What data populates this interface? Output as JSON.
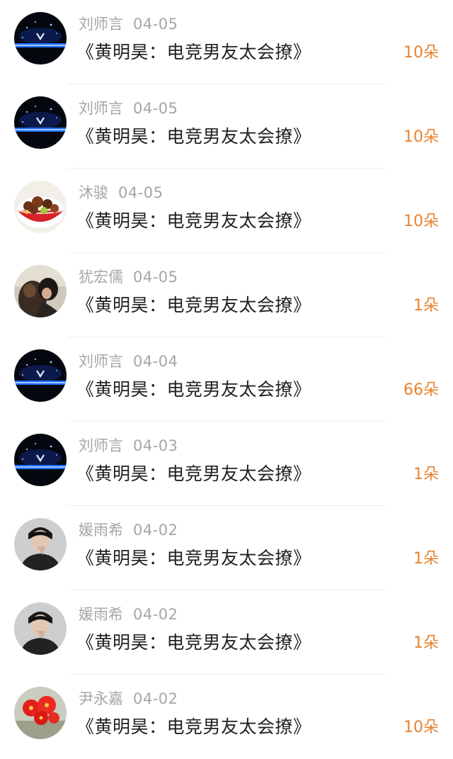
{
  "colors": {
    "gift_accent": "#e8822e",
    "meta_text": "#a6a6a6",
    "title_text": "#222222"
  },
  "items": [
    {
      "avatar": "galaxy-avatar",
      "name": "刘师言",
      "date": "04-05",
      "title": "《黄明昊：电竞男友太会撩》",
      "gift": "10朵"
    },
    {
      "avatar": "galaxy-avatar",
      "name": "刘师言",
      "date": "04-05",
      "title": "《黄明昊：电竞男友太会撩》",
      "gift": "10朵"
    },
    {
      "avatar": "food-bowl-avatar",
      "name": "沐骏",
      "date": "04-05",
      "title": "《黄明昊：电竞男友太会撩》",
      "gift": "10朵"
    },
    {
      "avatar": "person-dog-avatar",
      "name": "犹宏儒",
      "date": "04-05",
      "title": "《黄明昊：电竞男友太会撩》",
      "gift": "1朵"
    },
    {
      "avatar": "galaxy-avatar",
      "name": "刘师言",
      "date": "04-04",
      "title": "《黄明昊：电竞男友太会撩》",
      "gift": "66朵"
    },
    {
      "avatar": "galaxy-avatar",
      "name": "刘师言",
      "date": "04-03",
      "title": "《黄明昊：电竞男友太会撩》",
      "gift": "1朵"
    },
    {
      "avatar": "man-portrait-avatar",
      "name": "媛雨希",
      "date": "04-02",
      "title": "《黄明昊：电竞男友太会撩》",
      "gift": "1朵"
    },
    {
      "avatar": "man-portrait-avatar",
      "name": "媛雨希",
      "date": "04-02",
      "title": "《黄明昊：电竞男友太会撩》",
      "gift": "1朵"
    },
    {
      "avatar": "red-flower-avatar",
      "name": "尹永嘉",
      "date": "04-02",
      "title": "《黄明昊：电竞男友太会撩》",
      "gift": "10朵"
    }
  ]
}
